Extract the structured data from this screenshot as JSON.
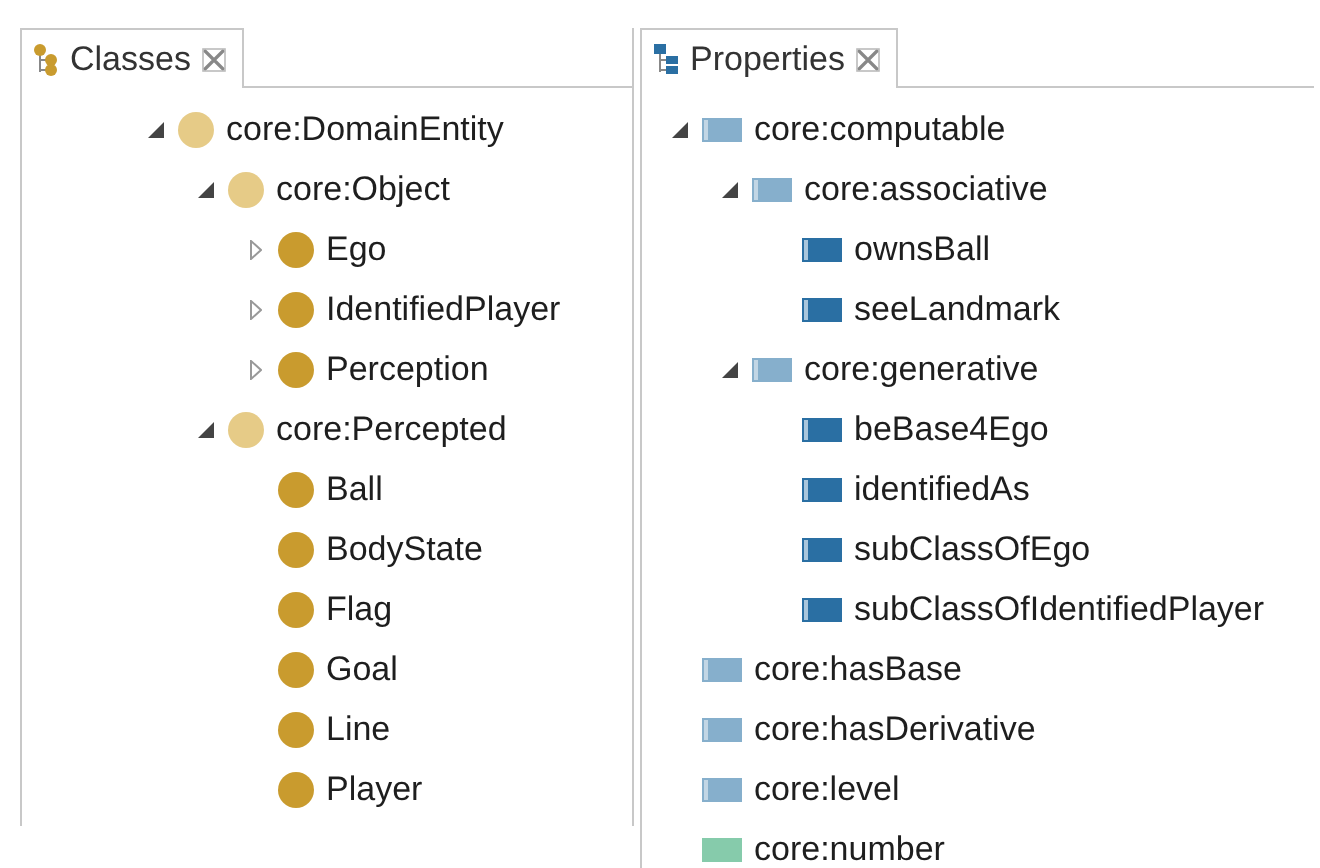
{
  "panels": [
    {
      "title": "Classes",
      "kind": "classes",
      "tree": [
        {
          "label": "core:DomainEntity",
          "kind": "namespace",
          "expanded": true,
          "children": [
            {
              "label": "core:Object",
              "kind": "namespace",
              "expanded": true,
              "children": [
                {
                  "label": "Ego",
                  "kind": "class",
                  "expanded": false
                },
                {
                  "label": "IdentifiedPlayer",
                  "kind": "class",
                  "expanded": false
                },
                {
                  "label": "Perception",
                  "kind": "class",
                  "expanded": false
                }
              ]
            },
            {
              "label": "core:Percepted",
              "kind": "namespace",
              "expanded": true,
              "children": [
                {
                  "label": "Ball",
                  "kind": "class"
                },
                {
                  "label": "BodyState",
                  "kind": "class"
                },
                {
                  "label": "Flag",
                  "kind": "class"
                },
                {
                  "label": "Goal",
                  "kind": "class"
                },
                {
                  "label": "Line",
                  "kind": "class"
                },
                {
                  "label": "Player",
                  "kind": "class"
                }
              ]
            }
          ]
        }
      ]
    },
    {
      "title": "Properties",
      "kind": "properties",
      "tree": [
        {
          "label": "core:computable",
          "kind": "group",
          "expanded": true,
          "children": [
            {
              "label": "core:associative",
              "kind": "group",
              "expanded": true,
              "children": [
                {
                  "label": "ownsBall",
                  "kind": "object"
                },
                {
                  "label": "seeLandmark",
                  "kind": "object"
                }
              ]
            },
            {
              "label": "core:generative",
              "kind": "group",
              "expanded": true,
              "children": [
                {
                  "label": "beBase4Ego",
                  "kind": "object"
                },
                {
                  "label": "identifiedAs",
                  "kind": "object"
                },
                {
                  "label": "subClassOfEgo",
                  "kind": "object"
                },
                {
                  "label": "subClassOfIdentifiedPlayer",
                  "kind": "object"
                }
              ]
            }
          ]
        },
        {
          "label": "core:hasBase",
          "kind": "group"
        },
        {
          "label": "core:hasDerivative",
          "kind": "group"
        },
        {
          "label": "core:level",
          "kind": "group"
        },
        {
          "label": "core:number",
          "kind": "data"
        }
      ]
    }
  ]
}
